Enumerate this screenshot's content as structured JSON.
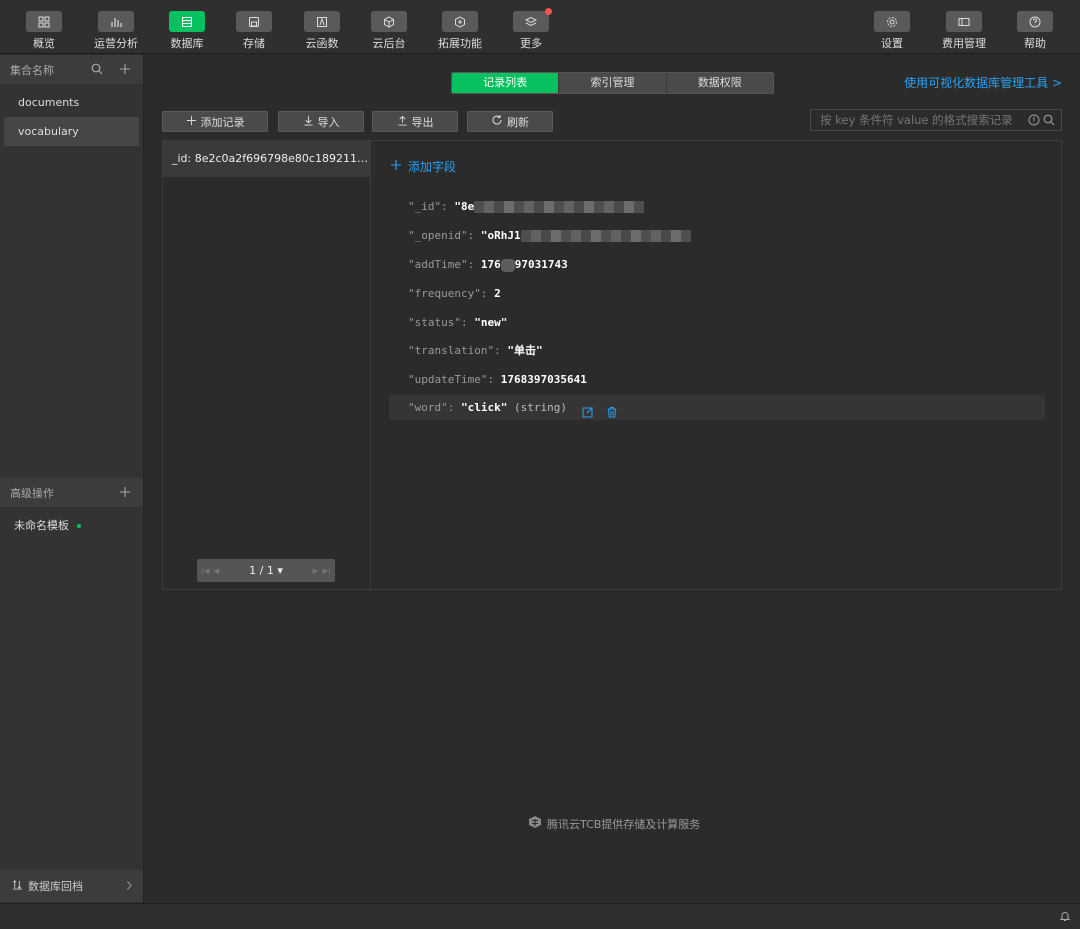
{
  "toolbar": {
    "left": [
      {
        "label": "概览",
        "icon": "grid-icon",
        "active": false
      },
      {
        "label": "运营分析",
        "icon": "bar-chart-icon",
        "active": false
      },
      {
        "label": "数据库",
        "icon": "database-icon",
        "active": true
      },
      {
        "label": "存储",
        "icon": "storage-icon",
        "active": false
      },
      {
        "label": "云函数",
        "icon": "function-icon",
        "active": false
      },
      {
        "label": "云后台",
        "icon": "cube-icon",
        "active": false
      },
      {
        "label": "拓展功能",
        "icon": "extension-icon",
        "active": false
      },
      {
        "label": "更多",
        "icon": "layers-icon",
        "active": false
      }
    ],
    "right": [
      {
        "label": "设置",
        "icon": "gear-icon"
      },
      {
        "label": "费用管理",
        "icon": "billing-icon"
      },
      {
        "label": "帮助",
        "icon": "help-icon"
      }
    ]
  },
  "sidebar": {
    "collections_header": "集合名称",
    "collections": [
      {
        "name": "documents",
        "selected": false
      },
      {
        "name": "vocabulary",
        "selected": true
      }
    ],
    "advanced_header": "高级操作",
    "templates": [
      {
        "name": "未命名模板"
      }
    ],
    "rollback_label": "数据库回档"
  },
  "tabs": [
    {
      "label": "记录列表",
      "active": true
    },
    {
      "label": "索引管理",
      "active": false
    },
    {
      "label": "数据权限",
      "active": false
    }
  ],
  "visual_tool_link": "使用可视化数据库管理工具 >",
  "actions": {
    "add_record": "添加记录",
    "import": "导入",
    "export": "导出",
    "refresh": "刷新"
  },
  "search": {
    "placeholder": "按 key 条件符 value 的格式搜索记录"
  },
  "records": [
    {
      "label": "_id: 8e2c0a2f696798e80c18921178..."
    }
  ],
  "pagination": {
    "text": "1 / 1 ▾"
  },
  "document": {
    "add_field_label": "添加字段",
    "fields": [
      {
        "key": "\"_id\"",
        "value": "\"8e",
        "redacted": true
      },
      {
        "key": "\"_openid\"",
        "value": "\"oRhJ1",
        "redacted": true
      },
      {
        "key": "\"addTime\"",
        "value_a": "176",
        "value_b": "97031743"
      },
      {
        "key": "\"frequency\"",
        "value": "2"
      },
      {
        "key": "\"status\"",
        "value": "\"new\""
      },
      {
        "key": "\"translation\"",
        "value": "\"单击\""
      },
      {
        "key": "\"updateTime\"",
        "value": "1768397035641"
      },
      {
        "key": "\"word\"",
        "value": "\"click\"",
        "type": "(string)"
      }
    ]
  },
  "footer_text": "腾讯云TCB提供存储及计算服务",
  "colors": {
    "accent": "#07c160",
    "link": "#2aa1f5",
    "badge": "#fa5151"
  }
}
